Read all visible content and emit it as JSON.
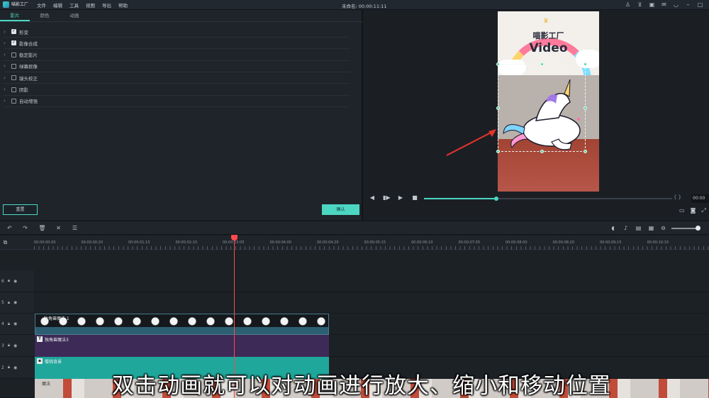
{
  "app": {
    "logo_text": "喵影工厂",
    "menu": [
      "文件",
      "编辑",
      "工具",
      "视图",
      "导出",
      "帮助"
    ],
    "title": "未命名: 00:00:11:11"
  },
  "effects_panel": {
    "tabs": [
      "影片",
      "颜色",
      "动画"
    ],
    "items": [
      {
        "label": "形变",
        "checked": true
      },
      {
        "label": "影像合成",
        "checked": true
      },
      {
        "label": "稳定影片",
        "checked": false
      },
      {
        "label": "绿幕抠像",
        "checked": false
      },
      {
        "label": "镜头校正",
        "checked": false
      },
      {
        "label": "阴影",
        "checked": false
      },
      {
        "label": "自动增强",
        "checked": false
      }
    ],
    "reset_label": "重置",
    "ok_label": "确认"
  },
  "preview": {
    "watermark_title": "喵影工厂",
    "watermark_sub": "Video",
    "timecode": "00:00",
    "progress": 0.29,
    "accent": "#4cd6c2",
    "arrow_color": "#e8332a"
  },
  "timeline": {
    "ruler": [
      "00:00:00:00",
      "00:00:00:20",
      "00:00:01:15",
      "00:00:02:10",
      "00:00:03:05",
      "00:00:04:00",
      "00:00:04:20",
      "00:00:05:15",
      "00:00:06:10",
      "00:00:07:05",
      "00:00:08:00",
      "00:00:08:20",
      "00:00:09:15",
      "00:00:10:10"
    ],
    "tracks": [
      "6",
      "5",
      "4",
      "3",
      "2"
    ],
    "clips": {
      "unicorn": "独角兽魔法 1",
      "title": "独角兽魔法3",
      "bg": "樱桃背景",
      "video": "魔法"
    }
  },
  "subtitle": "双击动画就可以对动画进行放大、缩小和移动位置"
}
